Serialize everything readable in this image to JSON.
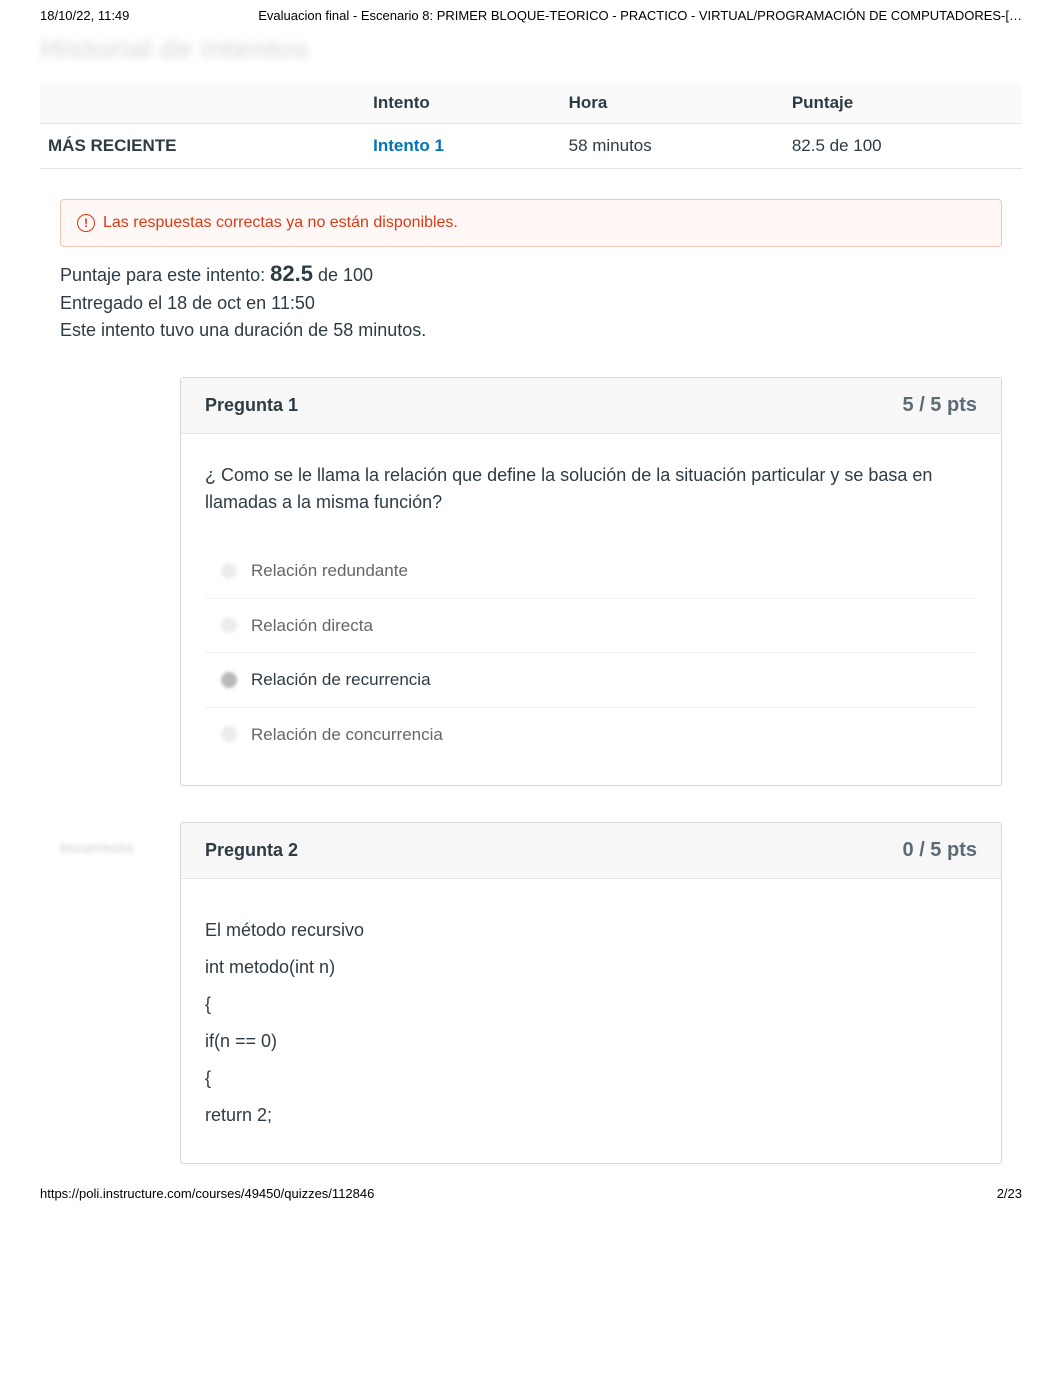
{
  "print_header": {
    "datetime": "18/10/22, 11:49",
    "title": "Evaluacion final - Escenario 8: PRIMER BLOQUE-TEORICO - PRACTICO - VIRTUAL/PROGRAMACIÓN DE COMPUTADORES-[…"
  },
  "blurred_heading": "Historial de intentos",
  "attempts_table": {
    "headers": {
      "c1": "",
      "c2": "Intento",
      "c3": "Hora",
      "c4": "Puntaje"
    },
    "row": {
      "label": "MÁS RECIENTE",
      "attempt": "Intento 1",
      "time": "58 minutos",
      "score": "82.5 de 100"
    }
  },
  "alert": {
    "icon_glyph": "!",
    "text": "Las respuestas correctas ya no están disponibles."
  },
  "summary": {
    "line1_prefix": "Puntaje para este intento: ",
    "line1_score": "82.5",
    "line1_suffix": " de 100",
    "line2": "Entregado el 18 de oct en 11:50",
    "line3": "Este intento tuvo una duración de 58 minutos."
  },
  "question1": {
    "status": "",
    "title": "Pregunta 1",
    "points": "5 / 5 pts",
    "text": "¿ Como se le llama la relación que define la solución de la situación particular y se basa en llamadas a la misma función?",
    "answers": [
      {
        "text": "Relación redundante",
        "selected": false
      },
      {
        "text": "Relación directa",
        "selected": false
      },
      {
        "text": "Relación de recurrencia",
        "selected": true
      },
      {
        "text": "Relación de concurrencia",
        "selected": false
      }
    ]
  },
  "question2": {
    "status": "Incorrecto",
    "title": "Pregunta 2",
    "points": "0 / 5 pts",
    "body_lines": [
      "El método recursivo",
      "int metodo(int n)",
      "{",
      "if(n == 0)",
      "{",
      " return 2;"
    ]
  },
  "print_footer": {
    "url": "https://poli.instructure.com/courses/49450/quizzes/112846",
    "page": "2/23"
  }
}
